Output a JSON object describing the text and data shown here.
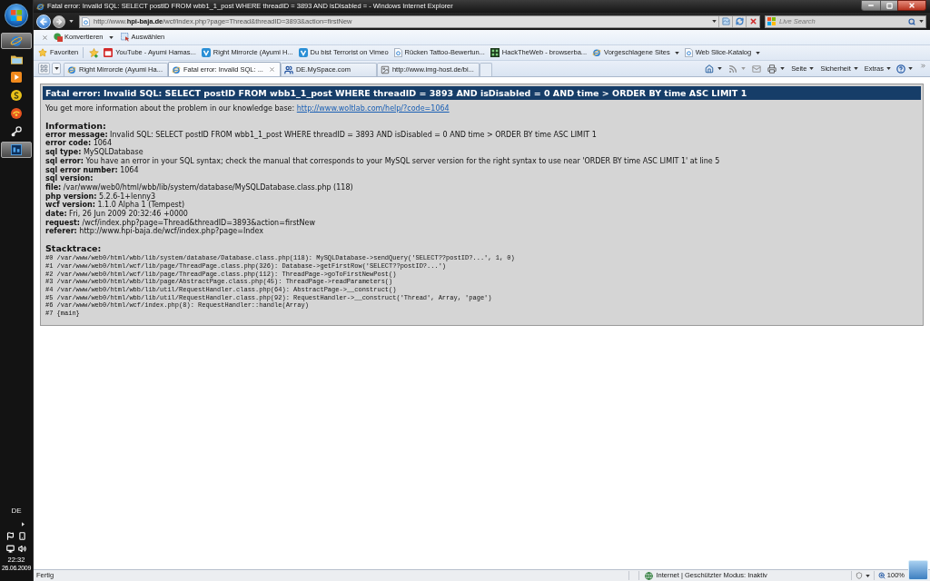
{
  "taskbar": {
    "apps": [
      {
        "kind": "browser",
        "selected": true
      },
      {
        "kind": "folder",
        "selected": false
      },
      {
        "kind": "media",
        "selected": false
      },
      {
        "kind": "messenger",
        "selected": false
      },
      {
        "kind": "chat",
        "selected": false
      },
      {
        "kind": "game",
        "selected": false
      },
      {
        "kind": "graphics",
        "selected": true
      }
    ],
    "language": "DE",
    "time": "22:32",
    "date": "26.06.2009"
  },
  "window": {
    "title": "Fatal error: Invalid SQL: SELECT postID FROM wbb1_1_post WHERE threadID = 3893 AND isDisabled = - Windows Internet Explorer"
  },
  "address_bar": {
    "url": "http://www.**hpi-baja.de**/wcf/index.php?page=Thread&threadID=3893&action=firstNew"
  },
  "search": {
    "placeholder": "Live Search"
  },
  "command_bar": {
    "items": [
      {
        "label": "Konvertieren",
        "dropdown": true
      },
      {
        "label": "Auswählen",
        "dropdown": false
      }
    ]
  },
  "favorites_bar": {
    "label": "Favoriten",
    "items": [
      {
        "kind": "video",
        "label": "YouTube - Ayumi Hamas...",
        "dropdown": false
      },
      {
        "kind": "clip",
        "label": "Right Mirrorcle (Ayumi H...",
        "dropdown": false
      },
      {
        "kind": "clip",
        "label": "Du bist Terrorist on Vimeo",
        "dropdown": false
      },
      {
        "kind": "page",
        "label": "Rücken  Tattoo-Bewertun...",
        "dropdown": false
      },
      {
        "kind": "tool",
        "label": "HackTheWeb - browserba...",
        "dropdown": false
      },
      {
        "kind": "sites",
        "label": "Vorgeschlagene Sites",
        "dropdown": true
      },
      {
        "kind": "page",
        "label": "Web Slice-Katalog",
        "dropdown": true
      }
    ]
  },
  "tabs": [
    {
      "kind": "page",
      "label": "Right Mirrorcle (Ayumi Ha...",
      "selected": false
    },
    {
      "kind": "page",
      "label": "Fatal error: Invalid SQL: ...",
      "selected": true
    },
    {
      "kind": "people",
      "label": "DE.MySpace.com",
      "selected": false
    },
    {
      "kind": "image",
      "label": "http://www.img-host.de/bi...",
      "selected": false
    }
  ],
  "toolbar": {
    "menus": [
      "Seite",
      "Sicherheit",
      "Extras"
    ]
  },
  "error_page": {
    "heading": "Fatal error: Invalid SQL: SELECT postID FROM wbb1_1_post WHERE threadID = 3893 AND isDisabled = 0 AND time > ORDER BY time ASC LIMIT 1",
    "intro": "You get more information about the problem in our knowledge base:",
    "link": "http://www.woltlab.com/help/?code=1064",
    "info_title": "Information:",
    "fields": [
      {
        "label": "error message:",
        "value": "Invalid SQL: SELECT postID FROM wbb1_1_post WHERE threadID = 3893 AND isDisabled = 0 AND time > ORDER BY time ASC LIMIT 1"
      },
      {
        "label": "error code:",
        "value": "1064"
      },
      {
        "label": "sql type:",
        "value": "MySQLDatabase"
      },
      {
        "label": "sql error:",
        "value": "You have an error in your SQL syntax; check the manual that corresponds to your MySQL server version for the right syntax to use near 'ORDER BY time ASC LIMIT 1' at line 5"
      },
      {
        "label": "sql error number:",
        "value": "1064"
      },
      {
        "label": "sql version:"
      },
      {
        "label": "file:",
        "value": "/var/www/web0/html/wbb/lib/system/database/MySQLDatabase.class.php (118)"
      },
      {
        "label": "php version:",
        "value": "5.2.6-1+lenny3"
      },
      {
        "label": "wcf version:",
        "value": "1.1.0 Alpha 1 (Tempest)"
      },
      {
        "label": "date:",
        "value": "Fri, 26 Jun 2009 20:32:46 +0000"
      },
      {
        "label": "request:",
        "value": "/wcf/index.php?page=Thread&threadID=3893&action=firstNew"
      },
      {
        "label": "referer:",
        "value": "http://www.hpi-baja.de/wcf/index.php?page=Index"
      }
    ],
    "stack_title": "Stacktrace:",
    "stack": [
      "#0 /var/www/web0/html/wbb/lib/system/database/Database.class.php(118): MySQLDatabase->sendQuery('SELECT??postID?...', 1, 0)",
      "#1 /var/www/web0/html/wcf/lib/page/ThreadPage.class.php(326): Database->getFirstRow('SELECT??postID?...')",
      "#2 /var/www/web0/html/wcf/lib/page/ThreadPage.class.php(112): ThreadPage->goToFirstNewPost()",
      "#3 /var/www/web0/html/wbb/lib/page/AbstractPage.class.php(45): ThreadPage->readParameters()",
      "#4 /var/www/web0/html/wbb/lib/util/RequestHandler.class.php(64): AbstractPage->__construct()",
      "#5 /var/www/web0/html/wbb/lib/util/RequestHandler.class.php(92): RequestHandler->__construct('Thread', Array, 'page')",
      "#6 /var/www/web0/html/wcf/index.php(8): RequestHandler::handle(Array)",
      "#7 {main}"
    ]
  },
  "status_bar": {
    "text": "Fertig",
    "zone": "Internet | Geschützter Modus: Inaktiv",
    "zoom": "100%"
  }
}
